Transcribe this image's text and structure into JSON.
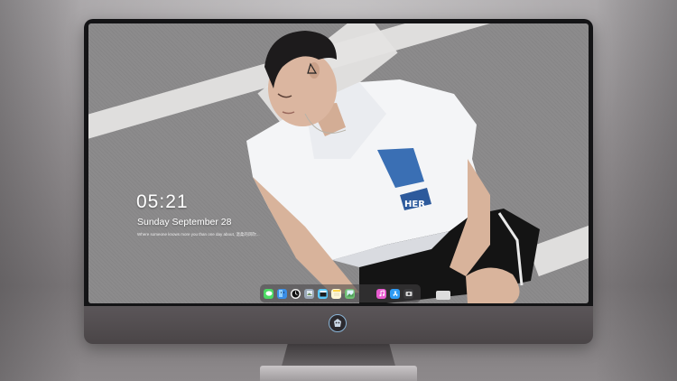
{
  "lock_screen": {
    "time": "05:21",
    "date": "Sunday September  28",
    "quote": "Where someone knows more you than one day about, 温柔的风吹..."
  },
  "dock": {
    "apps": [
      {
        "name": "messages",
        "icon": "messages-icon",
        "color": "#4cd964"
      },
      {
        "name": "finder",
        "icon": "finder-icon",
        "color": "#3a8ee6"
      },
      {
        "name": "clock",
        "icon": "clock-icon",
        "color": "#f2f2f2"
      },
      {
        "name": "preview",
        "icon": "preview-icon",
        "color": "#9aa8b8"
      },
      {
        "name": "claquette",
        "icon": "clapperboard-icon",
        "color": "#5ac8fa"
      },
      {
        "name": "notes",
        "icon": "notes-icon",
        "color": "#ffd54a"
      },
      {
        "name": "photos",
        "icon": "photos-icon",
        "color": "#6fbf73"
      },
      {
        "name": "itunes",
        "icon": "music-icon",
        "color": "#e85bd0"
      },
      {
        "name": "app-store",
        "icon": "app-store-icon",
        "color": "#2f9bf4"
      },
      {
        "name": "camera",
        "icon": "camera-icon",
        "color": "#3b3b3d"
      }
    ]
  },
  "colors": {
    "frame": "#141416",
    "chin": "#4f4a4d",
    "asphalt": "#8c8b8c",
    "road_stripe": "#e4e3e1",
    "shirt": "#f4f5f7",
    "shorts": "#141414"
  }
}
